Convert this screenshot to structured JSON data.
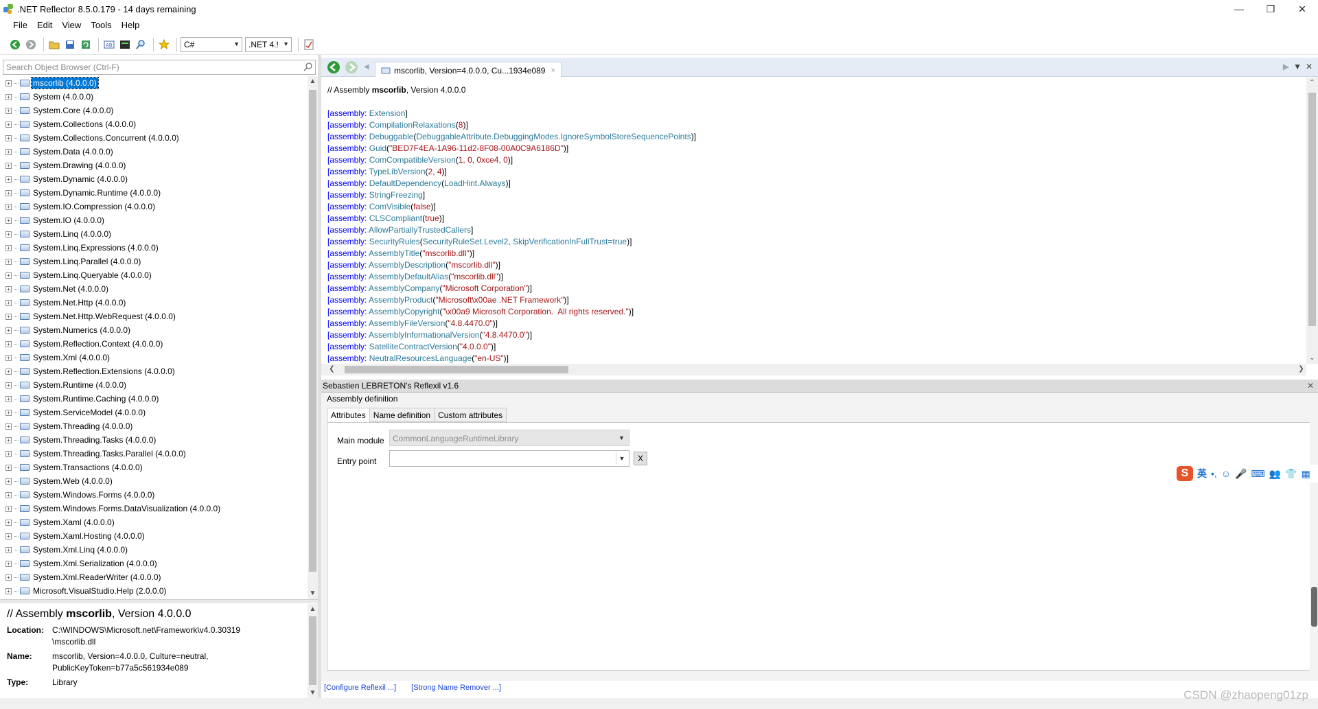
{
  "window": {
    "title": ".NET Reflector 8.5.0.179 - 14 days remaining"
  },
  "menu": [
    "File",
    "Edit",
    "View",
    "Tools",
    "Help"
  ],
  "toolbar": {
    "language": "C#",
    "framework": ".NET 4.!"
  },
  "left": {
    "search_placeholder": "Search Object Browser (Ctrl-F)",
    "assemblies": [
      "mscorlib (4.0.0.0)",
      "System (4.0.0.0)",
      "System.Core (4.0.0.0)",
      "System.Collections (4.0.0.0)",
      "System.Collections.Concurrent (4.0.0.0)",
      "System.Data (4.0.0.0)",
      "System.Drawing (4.0.0.0)",
      "System.Dynamic (4.0.0.0)",
      "System.Dynamic.Runtime (4.0.0.0)",
      "System.IO.Compression (4.0.0.0)",
      "System.IO (4.0.0.0)",
      "System.Linq (4.0.0.0)",
      "System.Linq.Expressions (4.0.0.0)",
      "System.Linq.Parallel (4.0.0.0)",
      "System.Linq.Queryable (4.0.0.0)",
      "System.Net (4.0.0.0)",
      "System.Net.Http (4.0.0.0)",
      "System.Net.Http.WebRequest (4.0.0.0)",
      "System.Numerics (4.0.0.0)",
      "System.Reflection.Context (4.0.0.0)",
      "System.Xml (4.0.0.0)",
      "System.Reflection.Extensions (4.0.0.0)",
      "System.Runtime (4.0.0.0)",
      "System.Runtime.Caching (4.0.0.0)",
      "System.ServiceModel (4.0.0.0)",
      "System.Threading (4.0.0.0)",
      "System.Threading.Tasks (4.0.0.0)",
      "System.Threading.Tasks.Parallel (4.0.0.0)",
      "System.Transactions (4.0.0.0)",
      "System.Web (4.0.0.0)",
      "System.Windows.Forms (4.0.0.0)",
      "System.Windows.Forms.DataVisualization (4.0.0.0)",
      "System.Xaml (4.0.0.0)",
      "System.Xaml.Hosting (4.0.0.0)",
      "System.Xml.Linq (4.0.0.0)",
      "System.Xml.Serialization (4.0.0.0)",
      "System.Xml.ReaderWriter (4.0.0.0)",
      "Microsoft.VisualStudio.Help (2.0.0.0)"
    ],
    "info": {
      "title_prefix": "// Assembly ",
      "title_name": "mscorlib",
      "title_suffix": ", Version 4.0.0.0",
      "location_label": "Location:",
      "location_value": "C:\\WINDOWS\\Microsoft.net\\Framework\\v4.0.30319\n\\mscorlib.dll",
      "name_label": "Name:",
      "name_value": "mscorlib, Version=4.0.0.0, Culture=neutral,\nPublicKeyToken=b77a5c561934e089",
      "type_label": "Type:",
      "type_value": "Library"
    }
  },
  "doc_tab": {
    "label": "mscorlib, Version=4.0.0.0, Cu...1934e089",
    "close": "×"
  },
  "code": {
    "header_prefix": "// Assembly ",
    "header_name": "mscorlib",
    "header_suffix": ", Version 4.0.0.0",
    "lines": [
      [
        [
          "k",
          "[assembly: "
        ],
        [
          "t",
          "Extension"
        ],
        [
          "c",
          "]"
        ]
      ],
      [
        [
          "k",
          "[assembly: "
        ],
        [
          "t",
          "CompilationRelaxations"
        ],
        [
          "c",
          "("
        ],
        [
          "s",
          "8"
        ],
        [
          "c",
          ")]"
        ]
      ],
      [
        [
          "k",
          "[assembly: "
        ],
        [
          "t",
          "Debuggable"
        ],
        [
          "c",
          "("
        ],
        [
          "t",
          "DebuggableAttribute.DebuggingModes.IgnoreSymbolStoreSequencePoints"
        ],
        [
          "c",
          ")]"
        ]
      ],
      [
        [
          "k",
          "[assembly: "
        ],
        [
          "t",
          "Guid"
        ],
        [
          "c",
          "("
        ],
        [
          "s",
          "\"BED7F4EA-1A96-11d2-8F08-00A0C9A6186D\""
        ],
        [
          "c",
          ")]"
        ]
      ],
      [
        [
          "k",
          "[assembly: "
        ],
        [
          "t",
          "ComCompatibleVersion"
        ],
        [
          "c",
          "("
        ],
        [
          "s",
          "1, 0, 0xce4, 0"
        ],
        [
          "c",
          ")]"
        ]
      ],
      [
        [
          "k",
          "[assembly: "
        ],
        [
          "t",
          "TypeLibVersion"
        ],
        [
          "c",
          "("
        ],
        [
          "s",
          "2, 4"
        ],
        [
          "c",
          ")]"
        ]
      ],
      [
        [
          "k",
          "[assembly: "
        ],
        [
          "t",
          "DefaultDependency"
        ],
        [
          "c",
          "("
        ],
        [
          "t",
          "LoadHint.Always"
        ],
        [
          "c",
          ")]"
        ]
      ],
      [
        [
          "k",
          "[assembly: "
        ],
        [
          "t",
          "StringFreezing"
        ],
        [
          "c",
          "]"
        ]
      ],
      [
        [
          "k",
          "[assembly: "
        ],
        [
          "t",
          "ComVisible"
        ],
        [
          "c",
          "("
        ],
        [
          "s",
          "false"
        ],
        [
          "c",
          ")]"
        ]
      ],
      [
        [
          "k",
          "[assembly: "
        ],
        [
          "t",
          "CLSCompliant"
        ],
        [
          "c",
          "("
        ],
        [
          "s",
          "true"
        ],
        [
          "c",
          ")]"
        ]
      ],
      [
        [
          "k",
          "[assembly: "
        ],
        [
          "t",
          "AllowPartiallyTrustedCallers"
        ],
        [
          "c",
          "]"
        ]
      ],
      [
        [
          "k",
          "[assembly: "
        ],
        [
          "t",
          "SecurityRules"
        ],
        [
          "c",
          "("
        ],
        [
          "t",
          "SecurityRuleSet.Level2, SkipVerificationInFullTrust=true"
        ],
        [
          "c",
          ")]"
        ]
      ],
      [
        [
          "k",
          "[assembly: "
        ],
        [
          "t",
          "AssemblyTitle"
        ],
        [
          "c",
          "("
        ],
        [
          "s",
          "\"mscorlib.dll\""
        ],
        [
          "c",
          ")]"
        ]
      ],
      [
        [
          "k",
          "[assembly: "
        ],
        [
          "t",
          "AssemblyDescription"
        ],
        [
          "c",
          "("
        ],
        [
          "s",
          "\"mscorlib.dll\""
        ],
        [
          "c",
          ")]"
        ]
      ],
      [
        [
          "k",
          "[assembly: "
        ],
        [
          "t",
          "AssemblyDefaultAlias"
        ],
        [
          "c",
          "("
        ],
        [
          "s",
          "\"mscorlib.dll\""
        ],
        [
          "c",
          ")]"
        ]
      ],
      [
        [
          "k",
          "[assembly: "
        ],
        [
          "t",
          "AssemblyCompany"
        ],
        [
          "c",
          "("
        ],
        [
          "s",
          "\"Microsoft Corporation\""
        ],
        [
          "c",
          ")]"
        ]
      ],
      [
        [
          "k",
          "[assembly: "
        ],
        [
          "t",
          "AssemblyProduct"
        ],
        [
          "c",
          "("
        ],
        [
          "s",
          "\"Microsoft\\x00ae .NET Framework\""
        ],
        [
          "c",
          ")]"
        ]
      ],
      [
        [
          "k",
          "[assembly: "
        ],
        [
          "t",
          "AssemblyCopyright"
        ],
        [
          "c",
          "("
        ],
        [
          "s",
          "\"\\x00a9 Microsoft Corporation.  All rights reserved.\""
        ],
        [
          "c",
          ")]"
        ]
      ],
      [
        [
          "k",
          "[assembly: "
        ],
        [
          "t",
          "AssemblyFileVersion"
        ],
        [
          "c",
          "("
        ],
        [
          "s",
          "\"4.8.4470.0\""
        ],
        [
          "c",
          ")]"
        ]
      ],
      [
        [
          "k",
          "[assembly: "
        ],
        [
          "t",
          "AssemblyInformationalVersion"
        ],
        [
          "c",
          "("
        ],
        [
          "s",
          "\"4.8.4470.0\""
        ],
        [
          "c",
          ")]"
        ]
      ],
      [
        [
          "k",
          "[assembly: "
        ],
        [
          "t",
          "SatelliteContractVersion"
        ],
        [
          "c",
          "("
        ],
        [
          "s",
          "\"4.0.0.0\""
        ],
        [
          "c",
          ")]"
        ]
      ],
      [
        [
          "k",
          "[assembly: "
        ],
        [
          "t",
          "NeutralResourcesLanguage"
        ],
        [
          "c",
          "("
        ],
        [
          "s",
          "\"en-US\""
        ],
        [
          "c",
          ")]"
        ]
      ]
    ]
  },
  "reflexil": {
    "header": "Sebastien LEBRETON's Reflexil v1.6",
    "section_title": "Assembly definition",
    "tabs": [
      "Attributes",
      "Name definition",
      "Custom attributes"
    ],
    "main_module_label": "Main module",
    "main_module_value": "CommonLanguageRuntimeLibrary",
    "entry_point_label": "Entry point",
    "entry_point_value": "",
    "clear_label": "X",
    "links": [
      "[Configure Reflexil ...]",
      "[Strong Name Remover ...]"
    ]
  },
  "ime": {
    "logo": "S",
    "mode": "英",
    "items": [
      "•,",
      "☺",
      "🎤",
      "⌨",
      "👥",
      "👕",
      "▦"
    ]
  },
  "watermark": "CSDN @zhaopeng01zp"
}
